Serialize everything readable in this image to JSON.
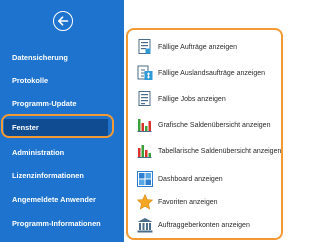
{
  "sidebar": {
    "back_icon": "back-arrow-icon",
    "items": [
      {
        "label": "Datensicherung"
      },
      {
        "label": "Protokolle"
      },
      {
        "label": "Programm-Update"
      },
      {
        "label": "Fenster",
        "selected": true
      },
      {
        "label": "Administration"
      },
      {
        "label": "Lizenzinformationen"
      },
      {
        "label": "Angemeldete Anwender"
      },
      {
        "label": "Programm-Informationen"
      }
    ]
  },
  "commands": [
    {
      "label": "Fällige Aufträge anzeigen",
      "icon": "document-list-icon"
    },
    {
      "label": "Fällige Auslandsaufträge anzeigen",
      "icon": "foreign-currency-document-icon"
    },
    {
      "label": "Fällige Jobs anzeigen",
      "icon": "jobs-document-icon"
    },
    {
      "label": "Grafische Saldenübersicht anzeigen",
      "icon": "bar-chart-icon"
    },
    {
      "label": "Tabellarische Saldenübersicht anzeigen",
      "icon": "table-chart-icon"
    },
    {
      "label": "Dashboard anzeigen",
      "icon": "dashboard-grid-icon"
    },
    {
      "label": "Favoriten anzeigen",
      "icon": "star-icon"
    },
    {
      "label": "Auftraggeberkonten anzeigen",
      "icon": "bank-building-icon"
    }
  ],
  "colors": {
    "sidebar_bg": "#1e73cf",
    "selected_bg": "#104c91",
    "highlight": "#f39a34"
  }
}
